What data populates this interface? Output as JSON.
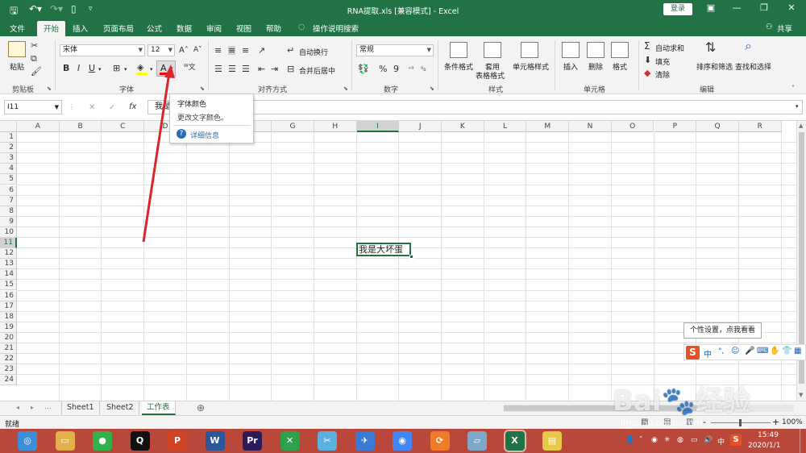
{
  "titlebar": {
    "title": "RNA提取.xls  [兼容模式]  -  Excel",
    "login_label": "登录",
    "minimize_glyph": "—",
    "restore_glyph": "❐",
    "close_glyph": "✕",
    "ribbon_display_glyph": "▣"
  },
  "tabs": {
    "file": "文件",
    "home": "开始",
    "insert": "插入",
    "page_layout": "页面布局",
    "formulas": "公式",
    "data": "数据",
    "review": "审阅",
    "view": "视图",
    "help": "帮助",
    "tell_me": "操作说明搜索",
    "share": "共享"
  },
  "ribbon": {
    "clipboard": {
      "paste": "粘贴",
      "label": "剪贴板"
    },
    "font": {
      "name": "宋体",
      "size": "12",
      "bold": "B",
      "italic": "I",
      "underline": "U",
      "label": "字体",
      "font_color_letter": "A",
      "font_color": "#ff0000",
      "highlight_color": "#ffff00"
    },
    "alignment": {
      "wrap": "自动换行",
      "merge": "合并后居中",
      "label": "对齐方式"
    },
    "number": {
      "format": "常规",
      "percent": "%",
      "comma": "9",
      "label": "数字"
    },
    "styles": {
      "conditional": "条件格式",
      "table_l1": "套用",
      "table_l2": "表格格式",
      "cell_styles": "单元格样式",
      "label": "样式"
    },
    "cells": {
      "insert": "插入",
      "delete": "删除",
      "format": "格式",
      "label": "单元格"
    },
    "editing": {
      "autosum": "自动求和",
      "fill": "填充",
      "clear": "清除",
      "sort": "排序和筛选",
      "find": "查找和选择",
      "label": "编辑"
    }
  },
  "formula_bar": {
    "name_box": "I11",
    "fx": "fx",
    "cancel": "✕",
    "enter": "✓",
    "content": "我是"
  },
  "tooltip": {
    "title": "字体颜色",
    "desc": "更改文字颜色。",
    "link": "详细信息"
  },
  "grid": {
    "columns": [
      "A",
      "B",
      "C",
      "D",
      "E",
      "F",
      "G",
      "H",
      "I",
      "J",
      "K",
      "L",
      "M",
      "N",
      "O",
      "P",
      "Q",
      "R"
    ],
    "rows": [
      "1",
      "2",
      "3",
      "4",
      "5",
      "6",
      "7",
      "8",
      "9",
      "10",
      "11",
      "12",
      "13",
      "14",
      "15",
      "16",
      "17",
      "18",
      "19",
      "20",
      "21",
      "22",
      "23",
      "24"
    ],
    "active_cell_value": "我是大坏蛋"
  },
  "sheets": {
    "tabs": [
      "Sheet1",
      "Sheet2",
      "工作表"
    ],
    "active": "工作表",
    "add": "⊕"
  },
  "status": {
    "ready": "就绪",
    "zoom": "100%",
    "zoom_minus": "-",
    "zoom_plus": "+"
  },
  "ime": {
    "tip": "个性设置，点我看看",
    "logo": "S",
    "lang": "中"
  },
  "taskbar": {
    "time": "15:49",
    "date": "2020/1/1",
    "apps": [
      "qq-browser",
      "file-explorer",
      "wechat",
      "qq",
      "powerpoint",
      "word",
      "premiere",
      "xmind",
      "snipaste",
      "feishu",
      "chrome",
      "orange-app",
      "notes",
      "excel",
      "notepad"
    ]
  },
  "colors": {
    "excel_green": "#217346",
    "taskbar": "#b9473a",
    "arrow": "#d9262a"
  }
}
